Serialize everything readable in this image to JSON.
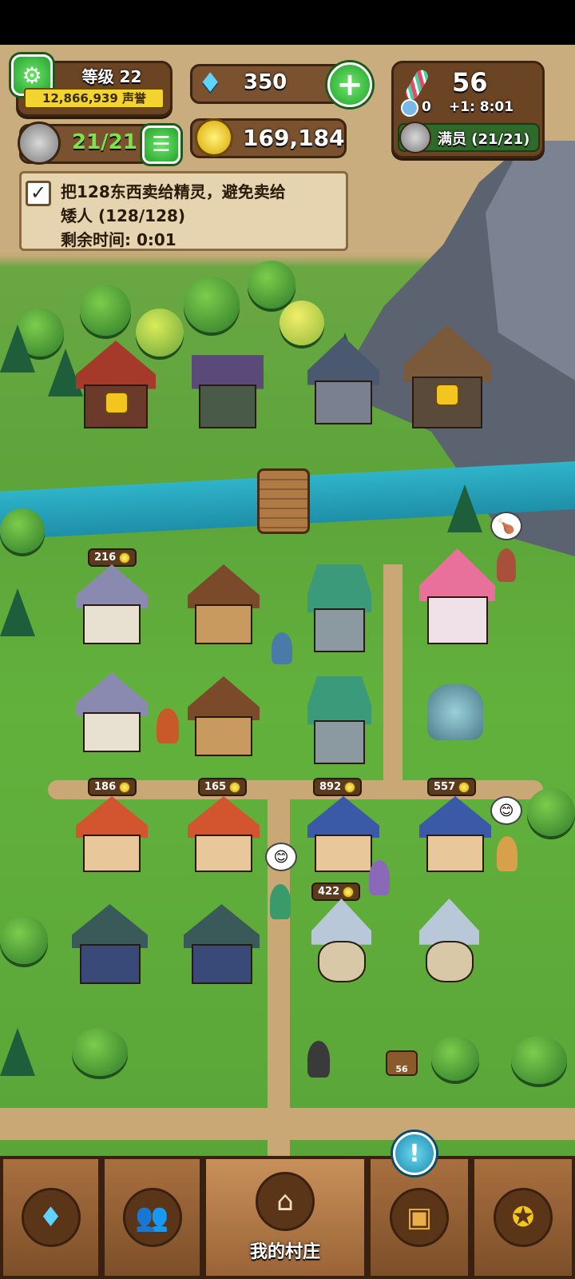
{
  "hud": {
    "level_label": "等级 22",
    "reputation": "12,866,939 声誉",
    "gems": "350",
    "gold": "169,184",
    "heroes": "21/21",
    "candy_count": "56",
    "unicorn_count": "0",
    "timer": "+1: 8:01",
    "party_status": "满员 (21/21)"
  },
  "quest": {
    "text_line1": "把128东西卖给精灵，避免卖给",
    "text_line2": "矮人 (128/128)",
    "text_line3": "剩余时间: 0:01"
  },
  "buildings": {
    "b1_badge": "216",
    "b2_badge": "186",
    "b3_badge": "165",
    "b4_badge": "892",
    "b5_badge": "557",
    "b6_badge": "422",
    "chest_badge": "56"
  },
  "nav": {
    "active_label": "我的村庄",
    "items": [
      {
        "icon": "gem-icon"
      },
      {
        "icon": "people-icon"
      },
      {
        "icon": "house-icon"
      },
      {
        "icon": "chest-icon"
      },
      {
        "icon": "medal-icon"
      }
    ]
  },
  "colors": {
    "accent_green": "#23a32e",
    "panel_brown": "#6b4423",
    "river": "#2fb4c9"
  }
}
